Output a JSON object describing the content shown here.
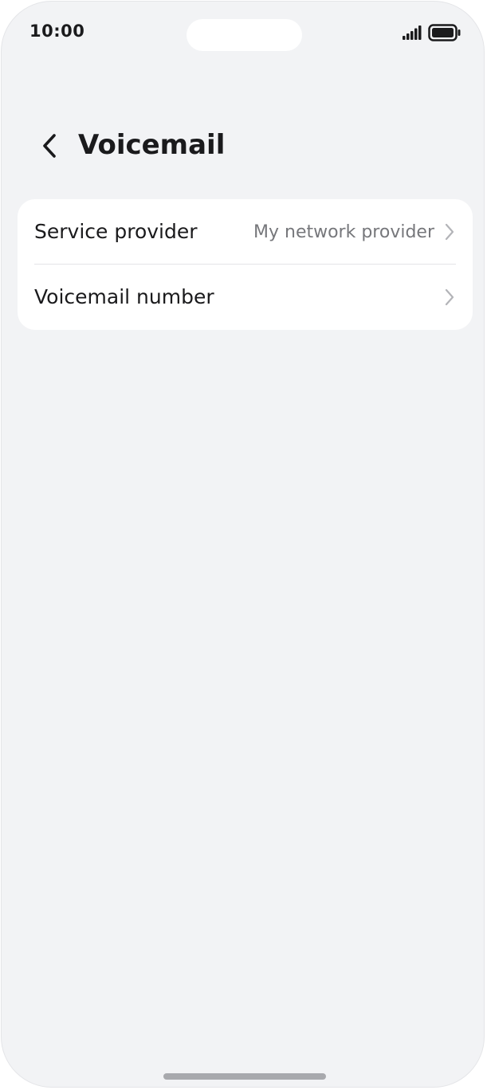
{
  "status_bar": {
    "time": "10:00",
    "signal_icon": "cellular-signal-icon",
    "battery_icon": "battery-full-icon"
  },
  "header": {
    "back_icon": "chevron-left-icon",
    "title": "Voicemail"
  },
  "settings": {
    "items": [
      {
        "label": "Service provider",
        "value": "My network provider",
        "icon": "chevron-right-icon"
      },
      {
        "label": "Voicemail number",
        "value": "",
        "icon": "chevron-right-icon"
      }
    ]
  },
  "colors": {
    "background": "#f2f3f5",
    "card": "#ffffff",
    "text_primary": "#1a1a1c",
    "text_secondary": "#76777b",
    "chevron": "#b3b4b8"
  }
}
